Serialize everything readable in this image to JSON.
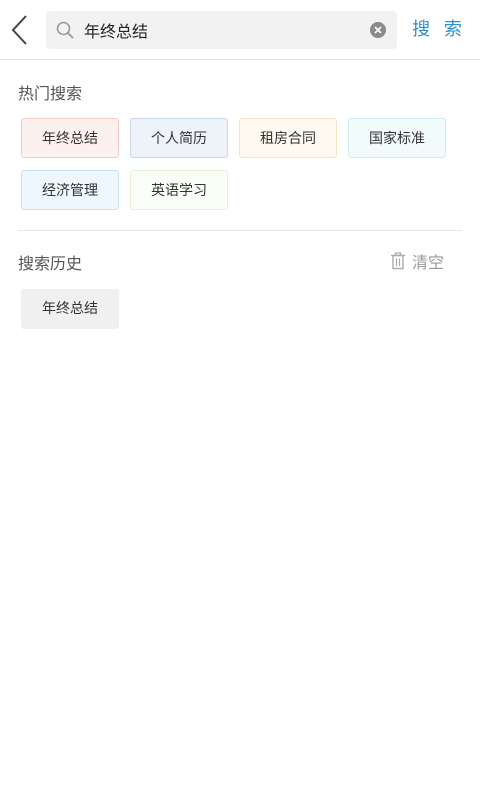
{
  "search": {
    "value": "年终总结",
    "button_label": "搜 索"
  },
  "hot": {
    "title": "热门搜索",
    "tags": [
      {
        "label": "年终总结",
        "bg": "#fdf1f0",
        "border": "#f6c9c4"
      },
      {
        "label": "个人简历",
        "bg": "#eef3f9",
        "border": "#c9d8ea"
      },
      {
        "label": "租房合同",
        "bg": "#fffaf1",
        "border": "#f6e3c1"
      },
      {
        "label": "国家标准",
        "bg": "#f2fbfc",
        "border": "#cdeef2"
      },
      {
        "label": "经济管理",
        "bg": "#eef7fd",
        "border": "#c4e3f6"
      },
      {
        "label": "英语学习",
        "bg": "#fafef6",
        "border": "#e2f3cf"
      }
    ]
  },
  "history": {
    "title": "搜索历史",
    "clear_label": "清空",
    "items": [
      "年终总结"
    ]
  },
  "colors": {
    "accent": "#2a8fd4"
  }
}
